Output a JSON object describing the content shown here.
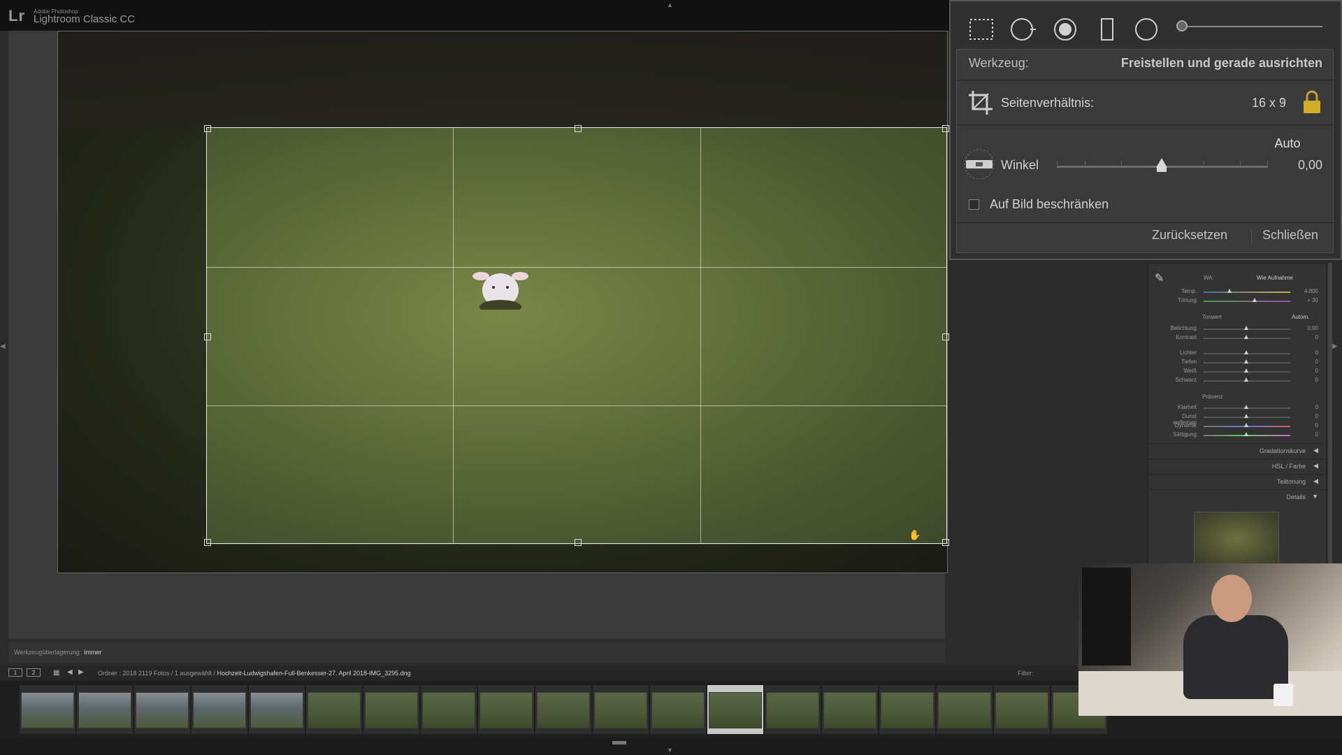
{
  "app": {
    "logo": "Lr",
    "brand": "Adobe Photoshop",
    "title": "Lightroom Classic CC"
  },
  "toolpanel": {
    "tool_label": "Werkzeug:",
    "tool_value": "Freistellen und gerade ausrichten",
    "aspect_label": "Seitenverhältnis:",
    "aspect_value": "16 x 9",
    "auto_label": "Auto",
    "angle_label": "Winkel",
    "angle_value": "0,00",
    "angle_slider_fraction": 0.5,
    "constrain_label": "Auf Bild beschränken",
    "constrain_checked": false,
    "reset_label": "Zurücksetzen",
    "close_label": "Schließen",
    "tools": [
      "crop-overlay-icon",
      "spot-removal-icon",
      "red-eye-icon",
      "graduated-filter-icon",
      "radial-filter-icon"
    ]
  },
  "develop": {
    "wb_label": "WA:",
    "wb_value": "Wie Aufnahme",
    "temp_label": "Temp.",
    "temp_value": "4.800",
    "tint_label": "Tönung",
    "tint_value": "+ 30",
    "tone_label": "Tonwert",
    "tone_auto": "Autom.",
    "exposure_label": "Belichtung",
    "exposure_value": "0,00",
    "contrast_label": "Kontrast",
    "contrast_value": "0",
    "highlights_label": "Lichter",
    "highlights_value": "0",
    "shadows_label": "Tiefen",
    "shadows_value": "0",
    "whites_label": "Weiß",
    "whites_value": "0",
    "blacks_label": "Schwarz",
    "blacks_value": "0",
    "presence_label": "Präsenz",
    "clarity_label": "Klarheit",
    "clarity_value": "0",
    "dehaze_label": "Dunst entfernen",
    "dehaze_value": "0",
    "vibrance_label": "Dynamik",
    "vibrance_value": "0",
    "saturation_label": "Sättigung",
    "saturation_value": "0",
    "sections": [
      "Gradationskurve",
      "HSL / Farbe",
      "Teiltonung",
      "Details"
    ]
  },
  "toolbar": {
    "overlay_label": "Werkzeugüberlagerung:",
    "overlay_value": "Immer"
  },
  "filmstrip": {
    "monitor1": "1",
    "monitor2": "2",
    "source": "Ordner : 2018    2119 Fotos /  1 ausgewählt /",
    "file": "Hochzeit-Ludwigshafen-Full-Benkesser-27. April 2018-IMG_3295.dng",
    "filter_label": "Filter:"
  },
  "colors": {
    "panel_bg": "#2f2f2f",
    "workarea_bg": "#3a3a3a",
    "filmstrip_bg": "#1e1e1e",
    "crop_border": "#e8e8e8"
  }
}
